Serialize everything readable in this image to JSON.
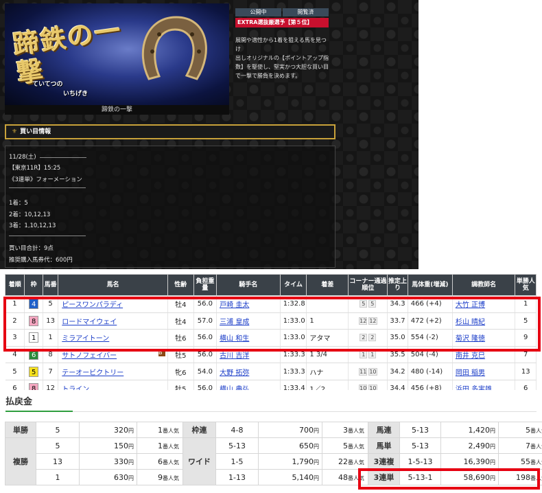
{
  "banner": {
    "logo_text": "蹄鉄の一撃",
    "logo_ruby_1": "ていてつの",
    "logo_ruby_2": "いちげき",
    "caption": "蹄鉄の一撃"
  },
  "status": {
    "public": "公開中",
    "viewed": "閲覧済"
  },
  "extra_badge": "EXTRA選抜厳選予【第５位】",
  "description": [
    "展開や適性から1着を狙える馬を見つけ",
    "出しオリジナルの【ポイントアップ指",
    "数】を駆使し、堅実かつ大胆な買い目",
    "で一撃で勝負を決めます。"
  ],
  "buy_info": {
    "header": "買い目情報",
    "date": "11/28(土)",
    "race": "【東京11R】15:25",
    "bet_type": "《3連単》フォーメーション",
    "first": "1着：5",
    "second": "2着：10,12,13",
    "third": "3着：1,10,12,13",
    "total": "買い目合計：9点",
    "recommended": "推奨購入馬券代：600円"
  },
  "results": {
    "headers": [
      "着順",
      "枠",
      "馬番",
      "馬名",
      "性齢",
      "負担重量",
      "騎手名",
      "タイム",
      "着差",
      "コーナー通過順位",
      "推定上り",
      "馬体重(増減)",
      "調教師名",
      "単勝人気"
    ],
    "rows": [
      {
        "rank": "1",
        "waku": "4",
        "num": "5",
        "horse": "ピースワンパラディ",
        "sex": "牡4",
        "weight": "56.0",
        "jockey": "戸崎 圭太",
        "time": "1:32.8",
        "margin": "",
        "corner": [
          "5",
          "5"
        ],
        "last": "34.3",
        "body": "466 (+4)",
        "trainer": "大竹 正博",
        "pop": "1",
        "blinker": ""
      },
      {
        "rank": "2",
        "waku": "8",
        "num": "13",
        "horse": "ロードマイウェイ",
        "sex": "牡4",
        "weight": "57.0",
        "jockey": "三浦 皇成",
        "time": "1:33.0",
        "margin": "1",
        "corner": [
          "12",
          "12"
        ],
        "last": "33.7",
        "body": "472 (+2)",
        "trainer": "杉山 晴紀",
        "pop": "5",
        "blinker": ""
      },
      {
        "rank": "3",
        "waku": "1",
        "num": "1",
        "horse": "ミラアイトーン",
        "sex": "牡6",
        "weight": "56.0",
        "jockey": "横山 和生",
        "time": "1:33.0",
        "margin": "アタマ",
        "corner": [
          "2",
          "2"
        ],
        "last": "35.0",
        "body": "554 (-2)",
        "trainer": "菊沢 隆徳",
        "pop": "9",
        "blinker": ""
      },
      {
        "rank": "4",
        "waku": "6",
        "num": "8",
        "horse": "サトノフェイバー",
        "sex": "牡5",
        "weight": "56.0",
        "jockey": "古川 吉洋",
        "time": "1:33.3",
        "margin": "1 3/4",
        "corner": [
          "1",
          "1"
        ],
        "last": "35.5",
        "body": "504 (-4)",
        "trainer": "南井 克巳",
        "pop": "7",
        "blinker": "B"
      },
      {
        "rank": "5",
        "waku": "5",
        "num": "7",
        "horse": "テーオービクトリー",
        "sex": "牝6",
        "weight": "54.0",
        "jockey": "大野 拓弥",
        "time": "1:33.3",
        "margin": "ハナ",
        "corner": [
          "11",
          "10"
        ],
        "last": "34.2",
        "body": "480 (-14)",
        "trainer": "岡田 稲男",
        "pop": "13",
        "blinker": ""
      },
      {
        "rank": "6",
        "waku": "8",
        "num": "12",
        "horse": "トライン",
        "sex": "牡5",
        "weight": "56.0",
        "jockey": "横山 典弘",
        "time": "1:33.4",
        "margin": "1／2",
        "corner": [
          "10",
          "10"
        ],
        "last": "34.4",
        "body": "456 (+8)",
        "trainer": "浜田 多実雄",
        "pop": "6",
        "blinker": ""
      }
    ]
  },
  "waku_colors": {
    "1": {
      "bg": "#ffffff",
      "fg": "#000000"
    },
    "4": {
      "bg": "#1f5fc8",
      "fg": "#ffffff"
    },
    "5": {
      "bg": "#f5e020",
      "fg": "#000000"
    },
    "6": {
      "bg": "#2a8a3a",
      "fg": "#ffffff"
    },
    "8": {
      "bg": "#f4a6c0",
      "fg": "#000000"
    }
  },
  "payout": {
    "title": "払戻金",
    "unit_yen": "円",
    "unit_pop": "番人気",
    "left": [
      {
        "type": "単勝",
        "rows": [
          {
            "num": "5",
            "yen": "320",
            "pop": "1"
          }
        ]
      },
      {
        "type": "複勝",
        "rows": [
          {
            "num": "5",
            "yen": "150",
            "pop": "1"
          },
          {
            "num": "13",
            "yen": "330",
            "pop": "6"
          },
          {
            "num": "1",
            "yen": "630",
            "pop": "9"
          }
        ]
      }
    ],
    "middle": [
      {
        "type": "枠連",
        "rows": [
          {
            "num": "4-8",
            "yen": "700",
            "pop": "3"
          }
        ]
      },
      {
        "type": "ワイド",
        "rows": [
          {
            "num": "5-13",
            "yen": "650",
            "pop": "5"
          },
          {
            "num": "1-5",
            "yen": "1,790",
            "pop": "22"
          },
          {
            "num": "1-13",
            "yen": "5,140",
            "pop": "48"
          }
        ]
      }
    ],
    "right": [
      {
        "type": "馬連",
        "num": "5-13",
        "yen": "1,420",
        "pop": "5"
      },
      {
        "type": "馬単",
        "num": "5-13",
        "yen": "2,490",
        "pop": "7"
      },
      {
        "type": "3連複",
        "num": "1-5-13",
        "yen": "16,390",
        "pop": "55"
      },
      {
        "type": "3連単",
        "num": "5-13-1",
        "yen": "58,690",
        "pop": "198"
      }
    ]
  }
}
